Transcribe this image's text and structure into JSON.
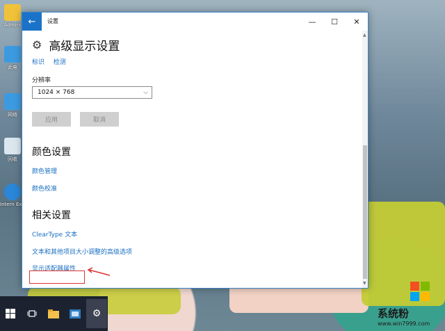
{
  "window": {
    "title": "设置",
    "back_label": "←",
    "minimize": "—",
    "maximize": "☐",
    "close": "✕"
  },
  "page": {
    "title": "高级显示设置",
    "links": [
      "标识",
      "检测"
    ]
  },
  "resolution": {
    "label": "分辨率",
    "value": "1024 × 768",
    "apply": "应用",
    "cancel": "取消"
  },
  "color_settings": {
    "title": "颜色设置",
    "links": [
      "颜色管理",
      "颜色校准"
    ]
  },
  "related_settings": {
    "title": "相关设置",
    "links": [
      "ClearType 文本",
      "文本和其他项目大小调整的高级选项",
      "显示适配器属性"
    ]
  },
  "desktop_icons": [
    {
      "label": "Admini",
      "color": "#f0c23a"
    },
    {
      "label": "此电",
      "color": "#3c9be0"
    },
    {
      "label": "网络",
      "color": "#3c9be0"
    },
    {
      "label": "回收",
      "color": "#dbe6ee"
    },
    {
      "label": "Intern Explo",
      "color": "#2a86d8"
    }
  ],
  "watermark": {
    "brand": "系统粉",
    "url": "www.win7999.com"
  },
  "colors": {
    "accent": "#1a73c8",
    "link": "#1a6fc0",
    "highlight_box": "#dd3333"
  },
  "icons": [
    "back-arrow-icon",
    "gear-icon",
    "chevron-down-icon",
    "task-view-icon",
    "file-explorer-icon",
    "mail-icon",
    "settings-icon",
    "windows-logo-icon"
  ]
}
